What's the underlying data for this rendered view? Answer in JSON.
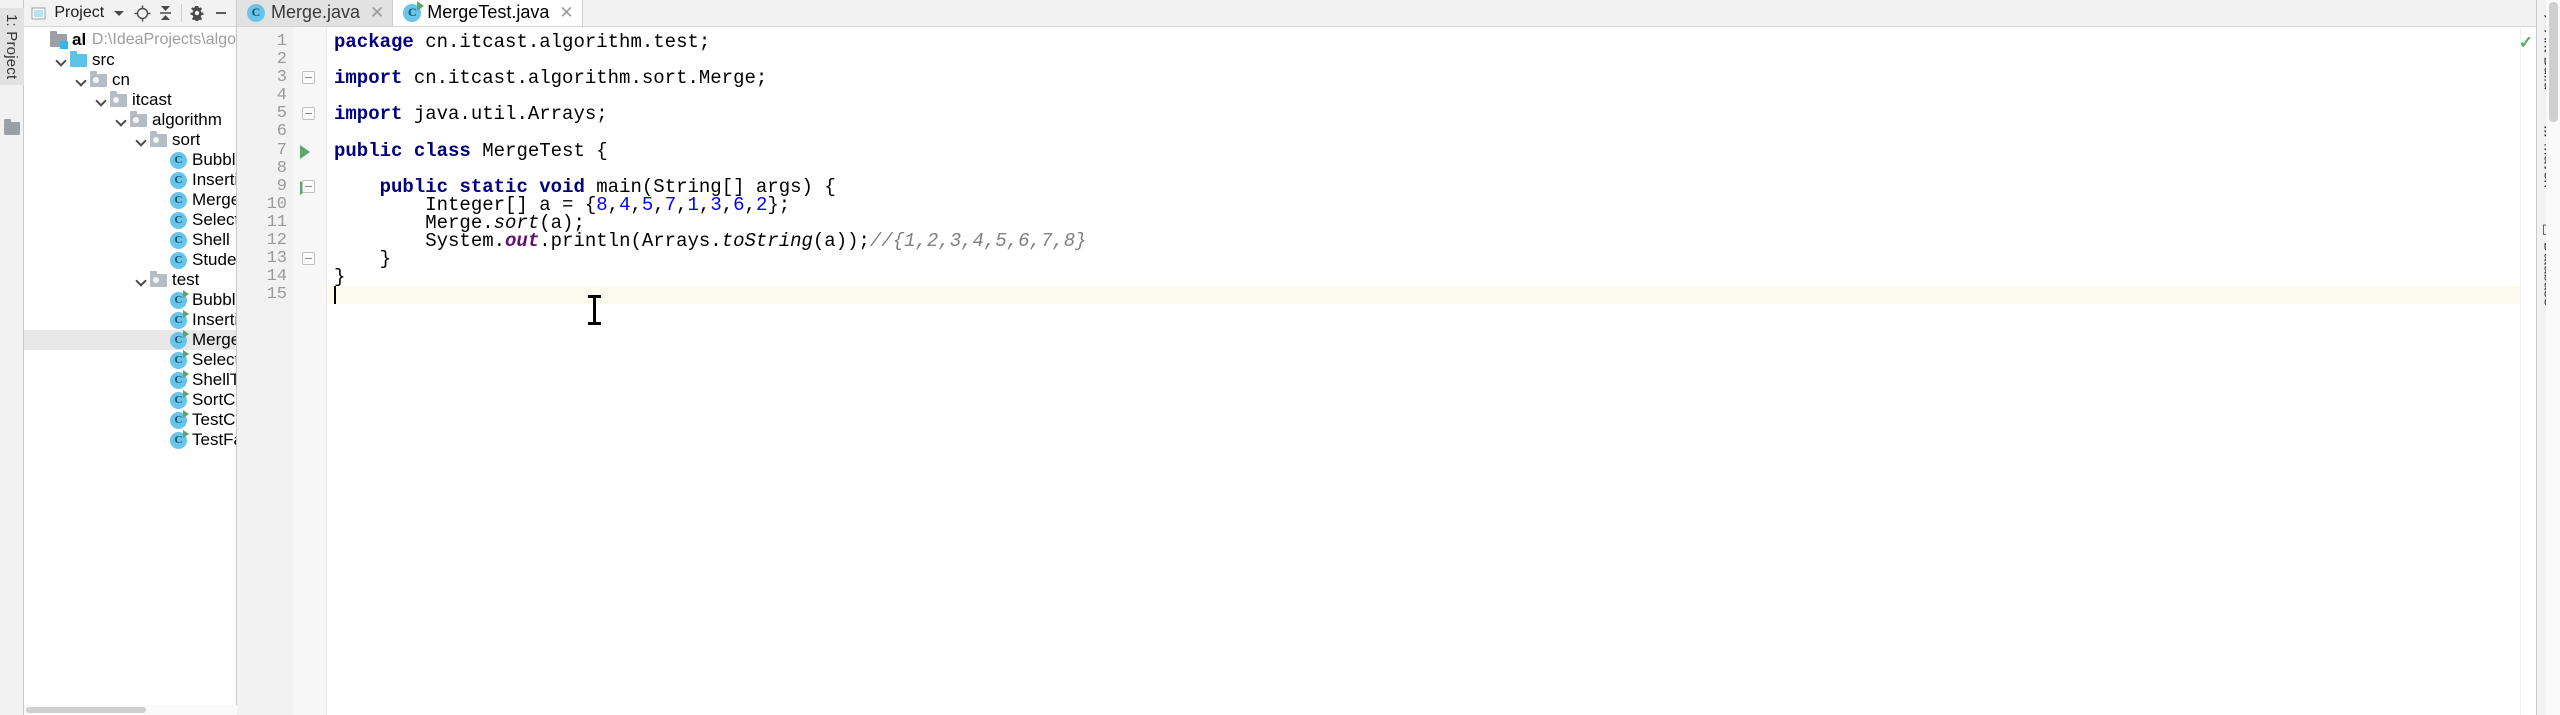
{
  "left_tool_strip": {
    "tabs": [
      {
        "label": "1: Project",
        "icon": "project-icon",
        "selected": true
      }
    ]
  },
  "project_panel": {
    "toolbar": {
      "title": "Project",
      "icons": [
        {
          "name": "project-view-icon",
          "glyph": "▣"
        },
        {
          "name": "dropdown-caret-icon",
          "glyph": "▾"
        },
        {
          "name": "locate-icon",
          "glyph": "⊕"
        },
        {
          "name": "collapse-all-icon",
          "glyph": "⤓"
        },
        {
          "name": "settings-gear-icon",
          "glyph": "⚙"
        },
        {
          "name": "hide-icon",
          "glyph": "—"
        }
      ]
    },
    "tree": [
      {
        "label": "algorithm",
        "path": "D:\\IdeaProjects\\algo",
        "indent": 0,
        "icon": "module",
        "chevron": false,
        "bold": true,
        "selected": false
      },
      {
        "label": "src",
        "indent": 1,
        "icon": "src-folder",
        "chevron": true,
        "bold": false,
        "selected": false
      },
      {
        "label": "cn",
        "indent": 2,
        "icon": "package",
        "chevron": true,
        "bold": false,
        "selected": false
      },
      {
        "label": "itcast",
        "indent": 3,
        "icon": "package",
        "chevron": true,
        "bold": false,
        "selected": false
      },
      {
        "label": "algorithm",
        "indent": 4,
        "icon": "package",
        "chevron": true,
        "bold": false,
        "selected": false
      },
      {
        "label": "sort",
        "indent": 5,
        "icon": "package",
        "chevron": true,
        "bold": false,
        "selected": false
      },
      {
        "label": "Bubble",
        "indent": 6,
        "icon": "java-class",
        "chevron": false,
        "bold": false,
        "selected": false
      },
      {
        "label": "Insertion",
        "indent": 6,
        "icon": "java-class",
        "chevron": false,
        "bold": false,
        "selected": false
      },
      {
        "label": "Merge",
        "indent": 6,
        "icon": "java-class",
        "chevron": false,
        "bold": false,
        "selected": false
      },
      {
        "label": "Selection",
        "indent": 6,
        "icon": "java-class",
        "chevron": false,
        "bold": false,
        "selected": false
      },
      {
        "label": "Shell",
        "indent": 6,
        "icon": "java-class",
        "chevron": false,
        "bold": false,
        "selected": false
      },
      {
        "label": "Student",
        "indent": 6,
        "icon": "java-class",
        "chevron": false,
        "bold": false,
        "selected": false
      },
      {
        "label": "test",
        "indent": 5,
        "icon": "package",
        "chevron": true,
        "bold": false,
        "selected": false
      },
      {
        "label": "BubbleTest",
        "indent": 6,
        "icon": "java-class-runnable",
        "chevron": false,
        "bold": false,
        "selected": false
      },
      {
        "label": "InsertionTe",
        "indent": 6,
        "icon": "java-class-runnable",
        "chevron": false,
        "bold": false,
        "selected": false
      },
      {
        "label": "MergeTest",
        "indent": 6,
        "icon": "java-class-runnable",
        "chevron": false,
        "bold": false,
        "selected": true
      },
      {
        "label": "SelectionTe",
        "indent": 6,
        "icon": "java-class-runnable",
        "chevron": false,
        "bold": false,
        "selected": false
      },
      {
        "label": "ShellTest",
        "indent": 6,
        "icon": "java-class-runnable",
        "chevron": false,
        "bold": false,
        "selected": false
      },
      {
        "label": "SortCompa",
        "indent": 6,
        "icon": "java-class-runnable",
        "chevron": false,
        "bold": false,
        "selected": false
      },
      {
        "label": "TestCompa",
        "indent": 6,
        "icon": "java-class-runnable",
        "chevron": false,
        "bold": false,
        "selected": false
      },
      {
        "label": "TestFactori",
        "indent": 6,
        "icon": "java-class-runnable",
        "chevron": false,
        "bold": false,
        "selected": false
      }
    ]
  },
  "editor": {
    "tabs": [
      {
        "label": "Merge.java",
        "icon": "java-class-icon",
        "active": false,
        "closable": true,
        "runnable": false
      },
      {
        "label": "MergeTest.java",
        "icon": "java-class-runnable-icon",
        "active": true,
        "closable": true,
        "runnable": true
      }
    ],
    "status_check": "✓",
    "line_numbers": [
      "1",
      "2",
      "3",
      "4",
      "5",
      "6",
      "7",
      "8",
      "9",
      "10",
      "11",
      "12",
      "13",
      "14",
      "15"
    ],
    "caret": {
      "line": 15,
      "column": 1
    },
    "lines": [
      {
        "n": 1,
        "tokens": [
          {
            "t": "package",
            "c": "kw"
          },
          {
            "t": " cn.itcast.algorithm.test;",
            "c": ""
          }
        ]
      },
      {
        "n": 2,
        "tokens": []
      },
      {
        "n": 3,
        "tokens": [
          {
            "t": "import",
            "c": "kw"
          },
          {
            "t": " cn.itcast.algorithm.sort.Merge;",
            "c": ""
          }
        ]
      },
      {
        "n": 4,
        "tokens": []
      },
      {
        "n": 5,
        "tokens": [
          {
            "t": "import",
            "c": "kw"
          },
          {
            "t": " java.util.Arrays;",
            "c": ""
          }
        ]
      },
      {
        "n": 6,
        "tokens": []
      },
      {
        "n": 7,
        "tokens": [
          {
            "t": "public",
            "c": "kw"
          },
          {
            "t": " ",
            "c": ""
          },
          {
            "t": "class",
            "c": "kw"
          },
          {
            "t": " MergeTest {",
            "c": ""
          }
        ]
      },
      {
        "n": 8,
        "tokens": []
      },
      {
        "n": 9,
        "tokens": [
          {
            "t": "    ",
            "c": ""
          },
          {
            "t": "public",
            "c": "kw"
          },
          {
            "t": " ",
            "c": ""
          },
          {
            "t": "static",
            "c": "kw"
          },
          {
            "t": " ",
            "c": ""
          },
          {
            "t": "void",
            "c": "kw"
          },
          {
            "t": " main(String[] args) {",
            "c": ""
          }
        ]
      },
      {
        "n": 10,
        "tokens": [
          {
            "t": "        Integer[] a = {",
            "c": ""
          },
          {
            "t": "8",
            "c": "num"
          },
          {
            "t": ",",
            "c": ""
          },
          {
            "t": "4",
            "c": "num"
          },
          {
            "t": ",",
            "c": ""
          },
          {
            "t": "5",
            "c": "num"
          },
          {
            "t": ",",
            "c": ""
          },
          {
            "t": "7",
            "c": "num"
          },
          {
            "t": ",",
            "c": ""
          },
          {
            "t": "1",
            "c": "num"
          },
          {
            "t": ",",
            "c": ""
          },
          {
            "t": "3",
            "c": "num"
          },
          {
            "t": ",",
            "c": ""
          },
          {
            "t": "6",
            "c": "num"
          },
          {
            "t": ",",
            "c": ""
          },
          {
            "t": "2",
            "c": "num"
          },
          {
            "t": "};",
            "c": ""
          }
        ]
      },
      {
        "n": 11,
        "tokens": [
          {
            "t": "        Merge.",
            "c": ""
          },
          {
            "t": "sort",
            "c": "mth"
          },
          {
            "t": "(a);",
            "c": ""
          }
        ]
      },
      {
        "n": 12,
        "tokens": [
          {
            "t": "        System.",
            "c": ""
          },
          {
            "t": "out",
            "c": "fld"
          },
          {
            "t": ".println(Arrays.",
            "c": ""
          },
          {
            "t": "toString",
            "c": "mth"
          },
          {
            "t": "(a));",
            "c": ""
          },
          {
            "t": "//{1,2,3,4,5,6,7,8}",
            "c": "cmt"
          }
        ]
      },
      {
        "n": 13,
        "tokens": [
          {
            "t": "    }",
            "c": ""
          }
        ]
      },
      {
        "n": 14,
        "tokens": [
          {
            "t": "}",
            "c": ""
          }
        ]
      },
      {
        "n": 15,
        "tokens": []
      }
    ],
    "run_markers": [
      7,
      9
    ],
    "fold_markers": [
      3,
      5,
      9,
      13
    ]
  },
  "right_tool_strip": {
    "tabs": [
      {
        "label": "Ant Build",
        "icon": "ant-icon",
        "glyph": "⁂"
      },
      {
        "label": "Maven",
        "icon": "maven-icon",
        "glyph": "m"
      },
      {
        "label": "Database",
        "icon": "database-icon",
        "glyph": "≡"
      }
    ]
  }
}
